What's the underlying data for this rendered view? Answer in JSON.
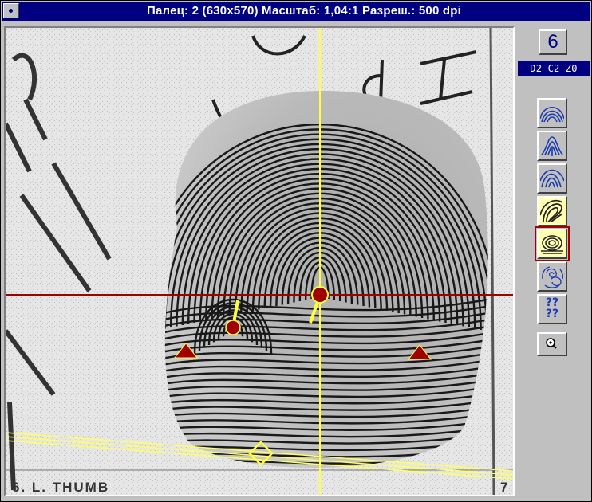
{
  "window": {
    "title": "Палец: 2 (630x570) Масштаб: 1,04:1  Разреш.: 500 dpi"
  },
  "image": {
    "card_caption": "6. L. THUMB",
    "corner_number": "7",
    "handwritten_marks": "dI",
    "markers": [
      {
        "type": "core",
        "icon": "core-marker-icon"
      },
      {
        "type": "core",
        "icon": "core-marker-icon"
      },
      {
        "type": "delta",
        "icon": "delta-marker-icon"
      },
      {
        "type": "delta",
        "icon": "delta-marker-icon"
      },
      {
        "type": "axis-point",
        "icon": "diamond-marker-icon"
      }
    ]
  },
  "panel": {
    "finger_number": "6",
    "codes": "D2  C2  Z0",
    "pattern_buttons": [
      {
        "name": "plain-arch",
        "icon": "plain-arch-icon"
      },
      {
        "name": "tented-arch",
        "icon": "tented-arch-icon"
      },
      {
        "name": "radial-loop",
        "icon": "radial-loop-icon"
      },
      {
        "name": "ulnar-loop",
        "icon": "ulnar-loop-icon"
      },
      {
        "name": "whorl",
        "icon": "whorl-icon"
      },
      {
        "name": "accidental",
        "icon": "accidental-icon"
      },
      {
        "name": "unknown",
        "icon": "unknown-pattern-icon",
        "label": "??\n??"
      }
    ],
    "zoom_icon": "zoom-in-icon"
  },
  "colors": {
    "titlebar": "#000080",
    "crosshair_h": "#a00000",
    "crosshair_v": "#ffff40",
    "marker": "#a00000",
    "selected_outline": "#a00000",
    "active_button": "#ffffb0"
  }
}
